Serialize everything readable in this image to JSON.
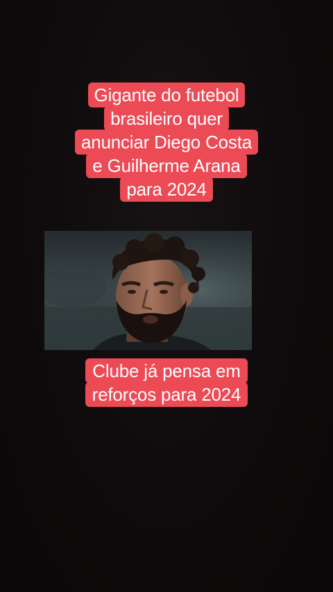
{
  "captions": {
    "top_lines": [
      "Gigante do futebol",
      "brasileiro quer",
      "anunciar Diego Costa",
      "e Guilherme Arana",
      "para 2024"
    ],
    "bottom_lines": [
      "Clube já pensa em",
      "reforços para 2024"
    ]
  },
  "colors": {
    "background": "#0e0b0c",
    "caption_bg": "#ec4a55",
    "caption_text": "#ffffff"
  }
}
